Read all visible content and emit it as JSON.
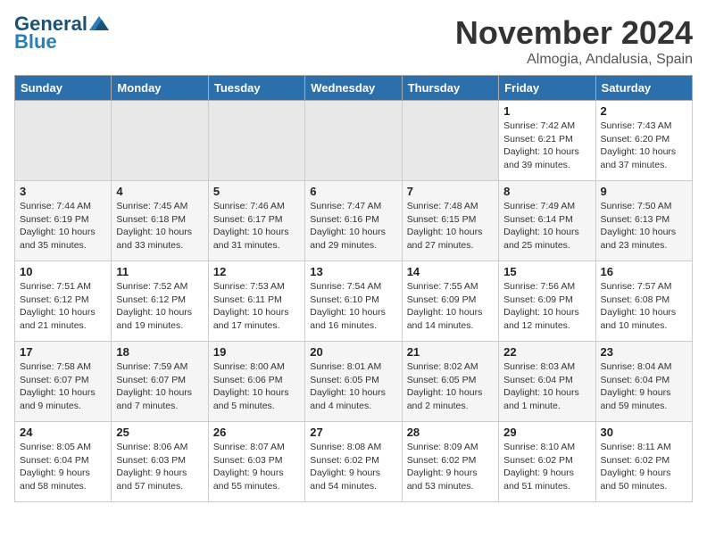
{
  "header": {
    "logo_general": "General",
    "logo_blue": "Blue",
    "title": "November 2024",
    "location": "Almogia, Andalusia, Spain"
  },
  "days_of_week": [
    "Sunday",
    "Monday",
    "Tuesday",
    "Wednesday",
    "Thursday",
    "Friday",
    "Saturday"
  ],
  "weeks": [
    [
      {
        "day": "",
        "info": ""
      },
      {
        "day": "",
        "info": ""
      },
      {
        "day": "",
        "info": ""
      },
      {
        "day": "",
        "info": ""
      },
      {
        "day": "",
        "info": ""
      },
      {
        "day": "1",
        "info": "Sunrise: 7:42 AM\nSunset: 6:21 PM\nDaylight: 10 hours\nand 39 minutes."
      },
      {
        "day": "2",
        "info": "Sunrise: 7:43 AM\nSunset: 6:20 PM\nDaylight: 10 hours\nand 37 minutes."
      }
    ],
    [
      {
        "day": "3",
        "info": "Sunrise: 7:44 AM\nSunset: 6:19 PM\nDaylight: 10 hours\nand 35 minutes."
      },
      {
        "day": "4",
        "info": "Sunrise: 7:45 AM\nSunset: 6:18 PM\nDaylight: 10 hours\nand 33 minutes."
      },
      {
        "day": "5",
        "info": "Sunrise: 7:46 AM\nSunset: 6:17 PM\nDaylight: 10 hours\nand 31 minutes."
      },
      {
        "day": "6",
        "info": "Sunrise: 7:47 AM\nSunset: 6:16 PM\nDaylight: 10 hours\nand 29 minutes."
      },
      {
        "day": "7",
        "info": "Sunrise: 7:48 AM\nSunset: 6:15 PM\nDaylight: 10 hours\nand 27 minutes."
      },
      {
        "day": "8",
        "info": "Sunrise: 7:49 AM\nSunset: 6:14 PM\nDaylight: 10 hours\nand 25 minutes."
      },
      {
        "day": "9",
        "info": "Sunrise: 7:50 AM\nSunset: 6:13 PM\nDaylight: 10 hours\nand 23 minutes."
      }
    ],
    [
      {
        "day": "10",
        "info": "Sunrise: 7:51 AM\nSunset: 6:12 PM\nDaylight: 10 hours\nand 21 minutes."
      },
      {
        "day": "11",
        "info": "Sunrise: 7:52 AM\nSunset: 6:12 PM\nDaylight: 10 hours\nand 19 minutes."
      },
      {
        "day": "12",
        "info": "Sunrise: 7:53 AM\nSunset: 6:11 PM\nDaylight: 10 hours\nand 17 minutes."
      },
      {
        "day": "13",
        "info": "Sunrise: 7:54 AM\nSunset: 6:10 PM\nDaylight: 10 hours\nand 16 minutes."
      },
      {
        "day": "14",
        "info": "Sunrise: 7:55 AM\nSunset: 6:09 PM\nDaylight: 10 hours\nand 14 minutes."
      },
      {
        "day": "15",
        "info": "Sunrise: 7:56 AM\nSunset: 6:09 PM\nDaylight: 10 hours\nand 12 minutes."
      },
      {
        "day": "16",
        "info": "Sunrise: 7:57 AM\nSunset: 6:08 PM\nDaylight: 10 hours\nand 10 minutes."
      }
    ],
    [
      {
        "day": "17",
        "info": "Sunrise: 7:58 AM\nSunset: 6:07 PM\nDaylight: 10 hours\nand 9 minutes."
      },
      {
        "day": "18",
        "info": "Sunrise: 7:59 AM\nSunset: 6:07 PM\nDaylight: 10 hours\nand 7 minutes."
      },
      {
        "day": "19",
        "info": "Sunrise: 8:00 AM\nSunset: 6:06 PM\nDaylight: 10 hours\nand 5 minutes."
      },
      {
        "day": "20",
        "info": "Sunrise: 8:01 AM\nSunset: 6:05 PM\nDaylight: 10 hours\nand 4 minutes."
      },
      {
        "day": "21",
        "info": "Sunrise: 8:02 AM\nSunset: 6:05 PM\nDaylight: 10 hours\nand 2 minutes."
      },
      {
        "day": "22",
        "info": "Sunrise: 8:03 AM\nSunset: 6:04 PM\nDaylight: 10 hours\nand 1 minute."
      },
      {
        "day": "23",
        "info": "Sunrise: 8:04 AM\nSunset: 6:04 PM\nDaylight: 9 hours\nand 59 minutes."
      }
    ],
    [
      {
        "day": "24",
        "info": "Sunrise: 8:05 AM\nSunset: 6:04 PM\nDaylight: 9 hours\nand 58 minutes."
      },
      {
        "day": "25",
        "info": "Sunrise: 8:06 AM\nSunset: 6:03 PM\nDaylight: 9 hours\nand 57 minutes."
      },
      {
        "day": "26",
        "info": "Sunrise: 8:07 AM\nSunset: 6:03 PM\nDaylight: 9 hours\nand 55 minutes."
      },
      {
        "day": "27",
        "info": "Sunrise: 8:08 AM\nSunset: 6:02 PM\nDaylight: 9 hours\nand 54 minutes."
      },
      {
        "day": "28",
        "info": "Sunrise: 8:09 AM\nSunset: 6:02 PM\nDaylight: 9 hours\nand 53 minutes."
      },
      {
        "day": "29",
        "info": "Sunrise: 8:10 AM\nSunset: 6:02 PM\nDaylight: 9 hours\nand 51 minutes."
      },
      {
        "day": "30",
        "info": "Sunrise: 8:11 AM\nSunset: 6:02 PM\nDaylight: 9 hours\nand 50 minutes."
      }
    ]
  ]
}
